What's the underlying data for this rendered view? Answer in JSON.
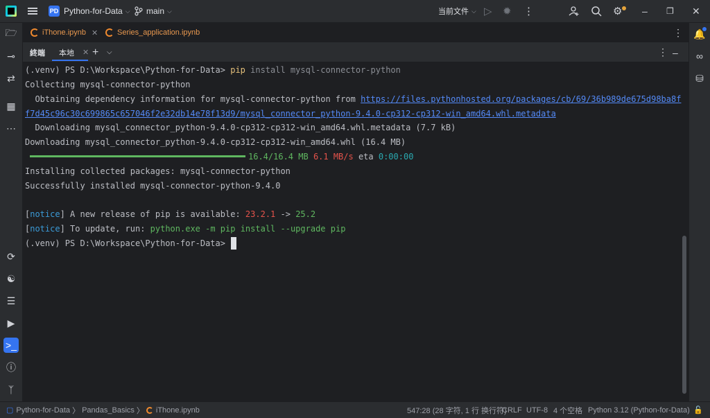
{
  "titlebar": {
    "project_badge": "PD",
    "project_name": "Python-for-Data",
    "branch": "main",
    "run_config": "当前文件",
    "icons": [
      "hamburger-menu-icon",
      "branch-icon",
      "run-icon",
      "debug-icon",
      "more-vertical-icon",
      "add-user-icon",
      "search-icon",
      "settings-icon",
      "minimize-icon",
      "restore-icon",
      "close-icon"
    ]
  },
  "file_tabs": [
    {
      "label": "iThone.ipynb"
    },
    {
      "label": "Series_application.ipynb"
    }
  ],
  "terminal_header": {
    "title": "終端",
    "tab_label": "本地"
  },
  "terminal": {
    "line1": {
      "prompt": "(.venv) PS D:\\Workspace\\Python-for-Data> ",
      "cmd": "pip",
      "args": " install mysql-connector-python"
    },
    "line2": "Collecting mysql-connector-python",
    "line3": {
      "text": "  Obtaining dependency information for mysql-connector-python from ",
      "link_a": "https://files.pythonhosted.org/packages/cb/69/36b989de675d98ba8f"
    },
    "line4": "f7d45c96c30c699865c657046f2e32db14e78f13d9/mysql_connector_python-9.4.0-cp312-cp312-win_amd64.whl.metadata",
    "line5": "  Downloading mysql_connector_python-9.4.0-cp312-cp312-win_amd64.whl.metadata (7.7 kB)",
    "line6": "Downloading mysql_connector_python-9.4.0-cp312-cp312-win_amd64.whl (16.4 MB)",
    "progress": {
      "fraction": 1.0,
      "size": "16.4/16.4 MB",
      "speed": "6.1 MB/s",
      "eta_label": " eta ",
      "eta": "0:00:00"
    },
    "line8": "Installing collected packages: mysql-connector-python",
    "line9": "Successfully installed mysql-connector-python-9.4.0",
    "notice1": {
      "open": "[",
      "tag": "notice",
      "close": "]",
      "text": " A new release of pip is available: ",
      "old": "23.2.1",
      "arrow": " -> ",
      "new": "25.2"
    },
    "notice2": {
      "open": "[",
      "tag": "notice",
      "close": "]",
      "text": " To update, run: ",
      "cmd": "python.exe -m pip install --upgrade pip"
    },
    "prompt_last": "(.venv) PS D:\\Workspace\\Python-for-Data>"
  },
  "statusbar": {
    "breadcrumb": [
      "Python-for-Data",
      "Pandas_Basics",
      "iThone.ipynb"
    ],
    "sep": "〉",
    "position": "547:28 (28 字符, 1 行 换行符)",
    "line_ending": "CRLF",
    "encoding": "UTF-8",
    "indent": "4 个空格",
    "interpreter": "Python 3.12 (Python-for-Data)"
  },
  "colors": {
    "accent": "#3574f0",
    "notebook_orange": "#e8984f",
    "terminal_green": "#5fb760",
    "terminal_red": "#e5534b",
    "link_blue": "#548af7"
  }
}
